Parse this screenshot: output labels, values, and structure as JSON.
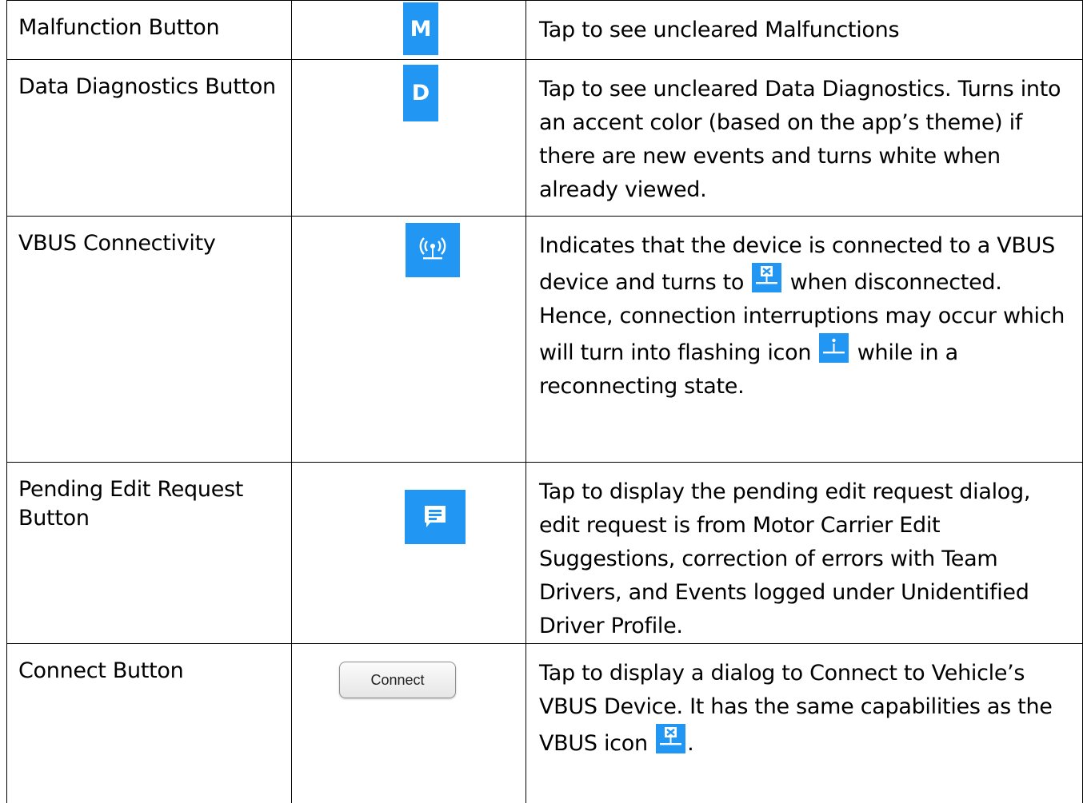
{
  "rows": [
    {
      "name": "Malfunction Button",
      "icon_letter": "M",
      "description": "Tap to see uncleared Malfunctions"
    },
    {
      "name": "Data Diagnostics Button",
      "icon_letter": "D",
      "description": "Tap to see uncleared Data Diagnostics. Turns into an accent color (based on the app’s theme) if there are new events and turns white when already viewed."
    },
    {
      "name": "VBUS Connectivity",
      "icon": "vbus-connected-icon",
      "desc_part1": "Indicates that the device is connected to a VBUS device and turns to",
      "desc_part2": "when disconnected. Hence, connection interruptions may occur which will turn into flashing icon",
      "desc_part3": "while in a reconnecting state."
    },
    {
      "name": "Pending Edit Request Button",
      "icon": "message-icon",
      "description": "Tap to display the pending edit request dialog, edit request is from Motor Carrier Edit Suggestions, correction of errors with Team Drivers, and Events logged under Unidentified Driver Profile."
    },
    {
      "name": "Connect Button",
      "button_label": "Connect",
      "desc_part1": "Tap to display a dialog to Connect to Vehicle’s VBUS Device. It has the same capabilities as the VBUS icon",
      "desc_part2": "."
    }
  ],
  "colors": {
    "icon_blue": "#2196f3"
  }
}
